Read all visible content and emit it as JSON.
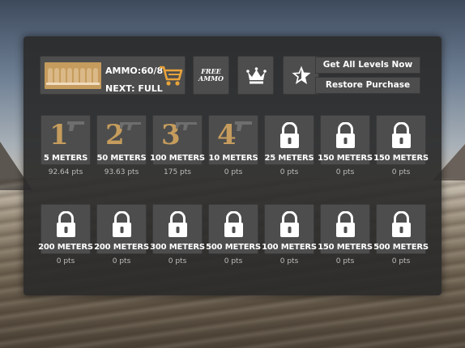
{
  "hud": {
    "ammo_label": "AMMO:60/8",
    "next_label": "NEXT:  FULL",
    "free_ammo_label": "FREE\nAMMO",
    "get_all_levels_label": "Get All Levels Now",
    "restore_purchase_label": "Restore Purchase"
  },
  "levels_row1": [
    {
      "number": "1",
      "meters": "5 METERS",
      "pts": "92.64 pts",
      "locked": false
    },
    {
      "number": "2",
      "meters": "50 METERS",
      "pts": "93.63 pts",
      "locked": false
    },
    {
      "number": "3",
      "meters": "100 METERS",
      "pts": "175 pts",
      "locked": false
    },
    {
      "number": "4",
      "meters": "10 METERS",
      "pts": "0 pts",
      "locked": false
    },
    {
      "number": "",
      "meters": "25 METERS",
      "pts": "0 pts",
      "locked": true
    },
    {
      "number": "",
      "meters": "150 METERS",
      "pts": "0 pts",
      "locked": true
    },
    {
      "number": "",
      "meters": "150 METERS",
      "pts": "0 pts",
      "locked": true
    }
  ],
  "levels_row2": [
    {
      "meters": "200 METERS",
      "pts": "0 pts",
      "locked": true
    },
    {
      "meters": "200 METERS",
      "pts": "0 pts",
      "locked": true
    },
    {
      "meters": "300 METERS",
      "pts": "0 pts",
      "locked": true
    },
    {
      "meters": "500 METERS",
      "pts": "0 pts",
      "locked": true
    },
    {
      "meters": "100 METERS",
      "pts": "0 pts",
      "locked": true
    },
    {
      "meters": "150 METERS",
      "pts": "0 pts",
      "locked": true
    },
    {
      "meters": "500 METERS",
      "pts": "0 pts",
      "locked": true
    }
  ],
  "colors": {
    "accent": "#c59c5d",
    "tile": "#4d4d4d",
    "panel": "#2a2a2a"
  },
  "icons": [
    "bullets-icon",
    "cart-icon",
    "crown-icon",
    "star-icon",
    "lock-icon",
    "rifle-icon"
  ]
}
